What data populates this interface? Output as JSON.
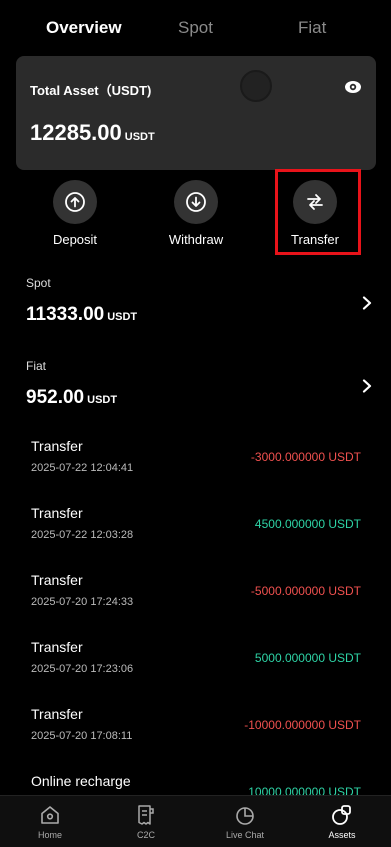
{
  "tabs": [
    "Overview",
    "Spot",
    "Fiat"
  ],
  "overview": {
    "label": "Total Asset（USDT)",
    "amount": "12285.00",
    "unit": "USDT"
  },
  "actions": {
    "deposit": "Deposit",
    "withdraw": "Withdraw",
    "transfer": "Transfer"
  },
  "spot": {
    "title": "Spot",
    "amount": "11333.00",
    "unit": "USDT"
  },
  "fiat": {
    "title": "Fiat",
    "amount": "952.00",
    "unit": "USDT"
  },
  "transactions": [
    {
      "title": "Transfer",
      "time": "2025-07-22 12:04:41",
      "amount": "-3000.000000 USDT",
      "sign": "neg"
    },
    {
      "title": "Transfer",
      "time": "2025-07-22 12:03:28",
      "amount": "4500.000000 USDT",
      "sign": "pos"
    },
    {
      "title": "Transfer",
      "time": "2025-07-20 17:24:33",
      "amount": "-5000.000000 USDT",
      "sign": "neg"
    },
    {
      "title": "Transfer",
      "time": "2025-07-20 17:23:06",
      "amount": "5000.000000 USDT",
      "sign": "pos"
    },
    {
      "title": "Transfer",
      "time": "2025-07-20 17:08:11",
      "amount": "-10000.000000 USDT",
      "sign": "neg"
    },
    {
      "title": "Online recharge",
      "time": "",
      "amount": "10000.000000 USDT",
      "sign": "pos"
    }
  ],
  "nav": [
    "Home",
    "C2C",
    "Live Chat",
    "Assets"
  ],
  "colors": {
    "negative": "#f0514f",
    "positive": "#2ed4a6",
    "highlight": "#e8131a"
  },
  "icons": [
    "eye-icon",
    "arrow-up-icon",
    "arrow-down-icon",
    "transfer-arrows-icon",
    "chevron-right-icon",
    "home-icon",
    "c2c-receipt-icon",
    "live-chat-icon",
    "assets-icon"
  ]
}
